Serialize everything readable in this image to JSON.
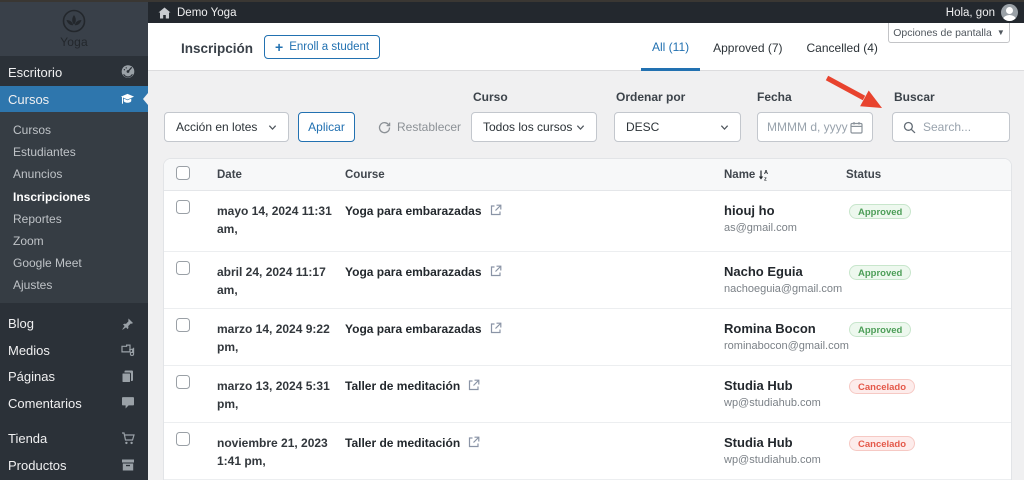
{
  "colors": {
    "accent_blue": "#2271b1",
    "sidebar_active_blue": "#2e76ad",
    "approved_green": "#4d9e58",
    "cancelled_red": "#e45849",
    "annotation_arrow_red": "#e8432e"
  },
  "sidebar": {
    "logo_text": "Yoga",
    "main_top": [
      {
        "label": "Escritorio",
        "icon": "dashboard-icon"
      },
      {
        "label": "Cursos",
        "icon": "graduation-cap-icon"
      }
    ],
    "submenu": [
      {
        "label": "Cursos"
      },
      {
        "label": "Estudiantes"
      },
      {
        "label": "Anuncios"
      },
      {
        "label": "Inscripciones",
        "active": true
      },
      {
        "label": "Reportes"
      },
      {
        "label": "Zoom"
      },
      {
        "label": "Google Meet"
      },
      {
        "label": "Ajustes"
      }
    ],
    "main_mid": [
      {
        "label": "Blog",
        "icon": "pushpin-icon"
      },
      {
        "label": "Medios",
        "icon": "media-icon"
      },
      {
        "label": "Páginas",
        "icon": "pages-icon"
      },
      {
        "label": "Comentarios",
        "icon": "comments-icon"
      }
    ],
    "main_bottom": [
      {
        "label": "Tienda",
        "icon": "cart-icon"
      },
      {
        "label": "Productos",
        "icon": "archive-icon"
      }
    ]
  },
  "admin_bar": {
    "site_name": "Demo Yoga",
    "greeting": "Hola, gon"
  },
  "header": {
    "title": "Inscripción",
    "enroll_button": "Enroll a student",
    "screen_options": "Opciones de pantalla",
    "tabs": [
      {
        "label": "All (11)",
        "active": true
      },
      {
        "label": "Approved (7)"
      },
      {
        "label": "Cancelled (4)"
      }
    ]
  },
  "filters": {
    "bulk_action_value": "Acción en lotes",
    "apply_label": "Aplicar",
    "reset_label": "Restablecer",
    "course_label": "Curso",
    "course_value": "Todos los cursos",
    "order_label": "Ordenar por",
    "order_value": "DESC",
    "date_label": "Fecha",
    "date_placeholder": "MMMM d, yyyy",
    "search_label": "Buscar",
    "search_placeholder": "Search..."
  },
  "table": {
    "headers": {
      "date": "Date",
      "course": "Course",
      "name": "Name",
      "status": "Status"
    },
    "rows": [
      {
        "date": "mayo 14, 2024 11:31 am,",
        "course": "Yoga para embarazadas",
        "name": "hiouj ho",
        "email": "as@gmail.com",
        "status": "Approved",
        "status_type": "approved"
      },
      {
        "date": "abril 24, 2024 11:17 am,",
        "course": "Yoga para embarazadas",
        "name": "Nacho Eguia",
        "email": "nachoeguia@gmail.com",
        "status": "Approved",
        "status_type": "approved"
      },
      {
        "date": "marzo 14, 2024 9:22 pm,",
        "course": "Yoga para embarazadas",
        "name": "Romina Bocon",
        "email": "rominabocon@gmail.com",
        "status": "Approved",
        "status_type": "approved"
      },
      {
        "date": "marzo 13, 2024 5:31 pm,",
        "course": "Taller de meditación",
        "name": "Studia Hub",
        "email": "wp@studiahub.com",
        "status": "Cancelado",
        "status_type": "cancelled"
      },
      {
        "date": "noviembre 21, 2023 1:41 pm,",
        "course": "Taller de meditación",
        "name": "Studia Hub",
        "email": "wp@studiahub.com",
        "status": "Cancelado",
        "status_type": "cancelled"
      }
    ]
  }
}
